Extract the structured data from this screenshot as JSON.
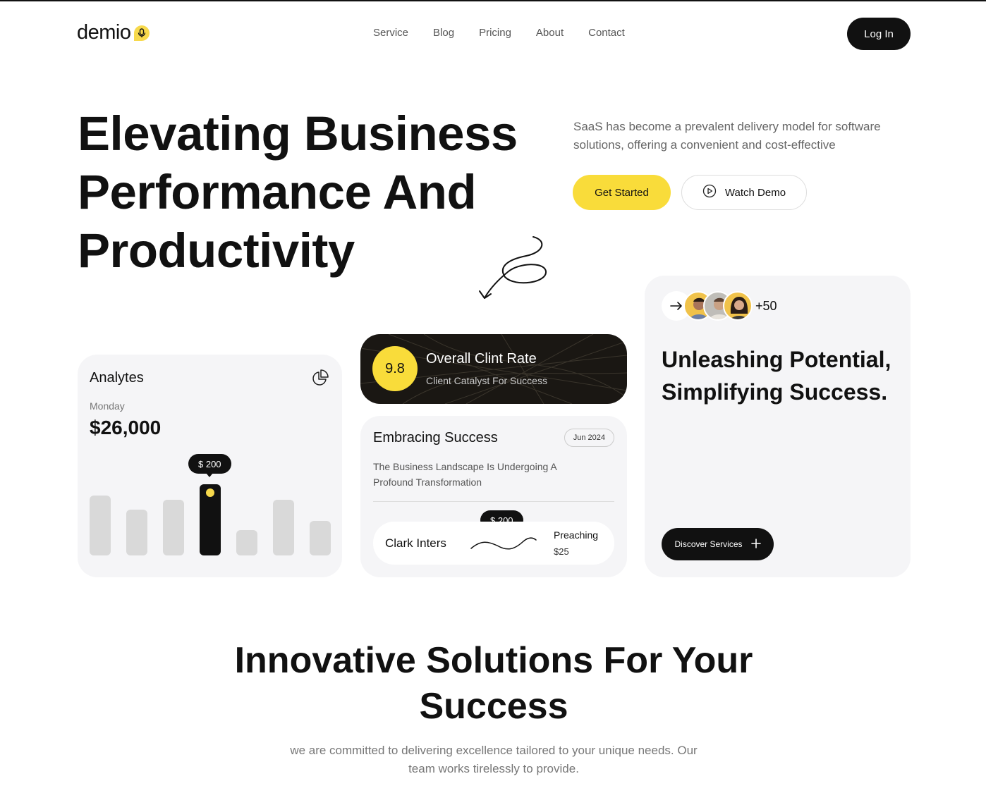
{
  "brand": {
    "name": "demio",
    "accent": "#f9dc3a"
  },
  "nav": {
    "items": [
      {
        "label": "Service"
      },
      {
        "label": "Blog"
      },
      {
        "label": "Pricing"
      },
      {
        "label": "About"
      },
      {
        "label": "Contact"
      }
    ],
    "login_label": "Log In"
  },
  "hero": {
    "title": "Elevating Business Performance And Productivity",
    "description": "SaaS has become a prevalent delivery model for software solutions, offering a convenient and cost-effective",
    "primary_cta": "Get Started",
    "secondary_cta": "Watch Demo",
    "secondary_cta_icon": "play-icon"
  },
  "analytics": {
    "title": "Analytes",
    "icon": "pie-chart-icon",
    "day": "Monday",
    "value": "$26,000",
    "tooltip": "$ 200",
    "bars": [
      0.69,
      0.53,
      0.64,
      0.82,
      0.29,
      0.64,
      0.4
    ],
    "active_index": 3
  },
  "rate": {
    "score": "9.8",
    "title": "Overall Clint Rate",
    "subtitle": "Client Catalyst For Success"
  },
  "embrace": {
    "title": "Embracing Success",
    "badge": "Jun 2024",
    "description": "The Business Landscape Is Undergoing A Profound Transformation",
    "name": "Clark Inters",
    "tooltip": "$ 200",
    "status": "Preaching",
    "price": "$25"
  },
  "unleash": {
    "count": "+50",
    "title": "Unleashing Potential, Simplifying Success.",
    "button_label": "Discover Services",
    "button_icon": "plus-icon",
    "arrow_icon": "arrow-right-icon"
  },
  "section2": {
    "title": "Innovative Solutions For Your Success",
    "description": "we are committed to delivering excellence tailored to your unique needs. Our team works tirelessly to provide."
  }
}
